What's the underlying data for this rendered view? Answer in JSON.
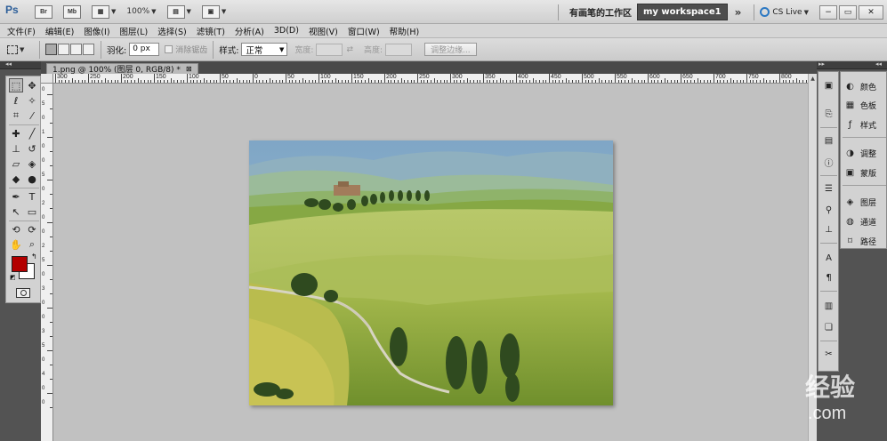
{
  "appbar": {
    "logo": "Ps",
    "bridge": "Br",
    "minibridge": "Mb",
    "zoom": "100%",
    "workspace_name": "有画笔的工作区",
    "workspace_active": "my workspace1",
    "more": "»",
    "cs_live": "CS Live",
    "window_controls": [
      "−",
      "▭",
      "✕"
    ]
  },
  "menu": [
    "文件(F)",
    "编辑(E)",
    "图像(I)",
    "图层(L)",
    "选择(S)",
    "滤镜(T)",
    "分析(A)",
    "3D(D)",
    "视图(V)",
    "窗口(W)",
    "帮助(H)"
  ],
  "options": {
    "feather_label": "羽化:",
    "feather_value": "0 px",
    "antialias_label": "消除锯齿",
    "style_label": "样式:",
    "style_value": "正常",
    "width_label": "宽度:",
    "height_label": "高度:",
    "refine_edge": "调整边缘..."
  },
  "document": {
    "tab_title": "1.png @ 100% (图层 0, RGB/8) *",
    "ruler_labels": [
      "300",
      "250",
      "200",
      "150",
      "100",
      "50",
      "0",
      "50",
      "100",
      "150",
      "200",
      "250",
      "300",
      "350",
      "400",
      "450",
      "500",
      "550",
      "600",
      "650",
      "700",
      "750",
      "800",
      "850"
    ],
    "vruler_labels": [
      "0",
      "5",
      "0",
      "1",
      "0",
      "0",
      "5",
      "0",
      "2",
      "0",
      "0",
      "2",
      "5",
      "0",
      "3",
      "0",
      "0",
      "3",
      "5",
      "0",
      "4",
      "0",
      "0"
    ]
  },
  "panels": [
    {
      "label": "颜色",
      "icon": "color-icon"
    },
    {
      "label": "色板",
      "icon": "swatches-icon"
    },
    {
      "label": "样式",
      "icon": "styles-icon"
    },
    {
      "label": "调整",
      "icon": "adjustments-icon"
    },
    {
      "label": "蒙版",
      "icon": "masks-icon"
    },
    {
      "label": "图层",
      "icon": "layers-icon"
    },
    {
      "label": "通道",
      "icon": "channels-icon"
    },
    {
      "label": "路径",
      "icon": "paths-icon"
    }
  ],
  "colors": {
    "foreground": "#b30000",
    "background": "#ffffff"
  },
  "watermark": {
    "text": ".com"
  }
}
